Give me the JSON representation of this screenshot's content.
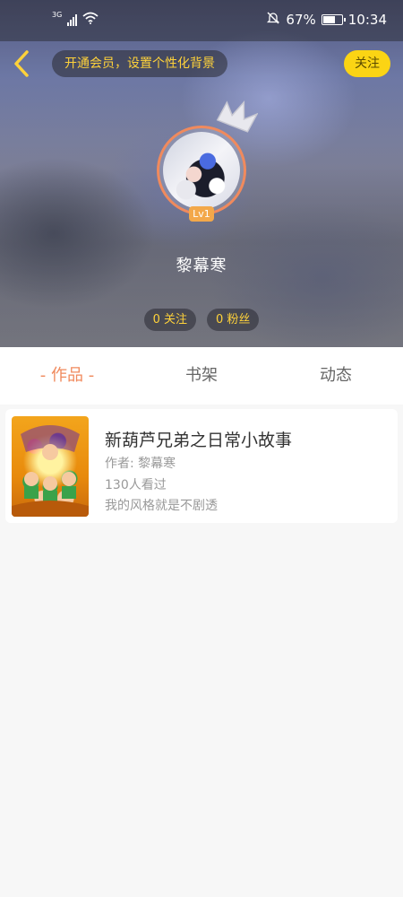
{
  "status_bar": {
    "network": "3G",
    "battery_level": 0.67,
    "battery_text": "67%",
    "time": "10:34",
    "icons": [
      "signal-icon",
      "wifi-icon",
      "mute-bell-icon",
      "battery-icon"
    ]
  },
  "header": {
    "back_icon": "chevron-left-icon",
    "vip_banner": "开通会员，设置个性化背景",
    "follow_label": "关注"
  },
  "profile": {
    "level_badge": "Lv1",
    "nickname": "黎幕寒",
    "following_text": "0 关注",
    "fans_text": "0 粉丝"
  },
  "tabs": [
    {
      "label": "- 作品 -",
      "active": true
    },
    {
      "label": "书架",
      "active": false
    },
    {
      "label": "动态",
      "active": false
    }
  ],
  "works": [
    {
      "title": "新葫芦兄弟之日常小故事",
      "author": "作者: 黎幕寒",
      "views": "130人看过",
      "description": "我的风格就是不剧透"
    }
  ],
  "colors": {
    "accent": "#f08a5d",
    "gold": "#ffd23a",
    "follow_bg": "#fbd414",
    "level_bg": "#f3a84a"
  }
}
